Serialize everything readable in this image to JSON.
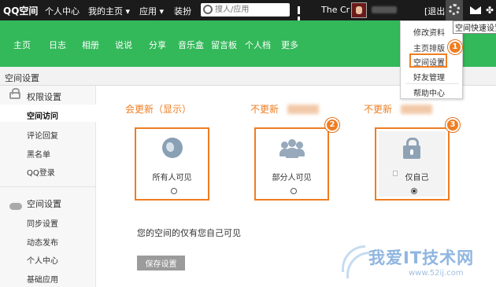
{
  "topbar": {
    "logo": "QQ空间",
    "nav": [
      "个人中心",
      "我的主页 ▾",
      "应用 ▾",
      "装扮"
    ],
    "search_placeholder": "搜人/应用",
    "user_name": "The Cr",
    "logout": "[退出]"
  },
  "greenbar": {
    "items": [
      "主页",
      "日志",
      "相册",
      "说说",
      "分享",
      "音乐盒",
      "留言板",
      "个人档",
      "更多"
    ]
  },
  "dropdown": {
    "items": [
      "修改资料",
      "主页排版",
      "空间设置",
      "好友管理",
      "帮助中心"
    ],
    "tooltip": "空间快速设置"
  },
  "badges": [
    "1",
    "2",
    "3"
  ],
  "page_header": "空间设置",
  "sidebar": {
    "section1_title": "权限设置",
    "section1_items": [
      "空间访问",
      "评论回复",
      "黑名单",
      "QQ登录"
    ],
    "section2_title": "空间设置",
    "section2_items": [
      "同步设置",
      "动态发布",
      "个人中心",
      "基础应用"
    ]
  },
  "annotations": [
    "会更新（显示）",
    "不更新",
    "不更新"
  ],
  "options": [
    {
      "label": "所有人可见",
      "checked": false
    },
    {
      "label": "部分人可见",
      "checked": false
    },
    {
      "label": "仅自己",
      "checked": true
    }
  ],
  "info_text": "您的空间的仅有您自己可见",
  "save_button": "保存设置",
  "watermark": {
    "title": "我爱IT技术网",
    "sub": "www.52ij.com"
  },
  "colors": {
    "accent_orange": "#ef7d21",
    "nav_green": "#33b85a",
    "topbar": "#1b1b1b"
  }
}
